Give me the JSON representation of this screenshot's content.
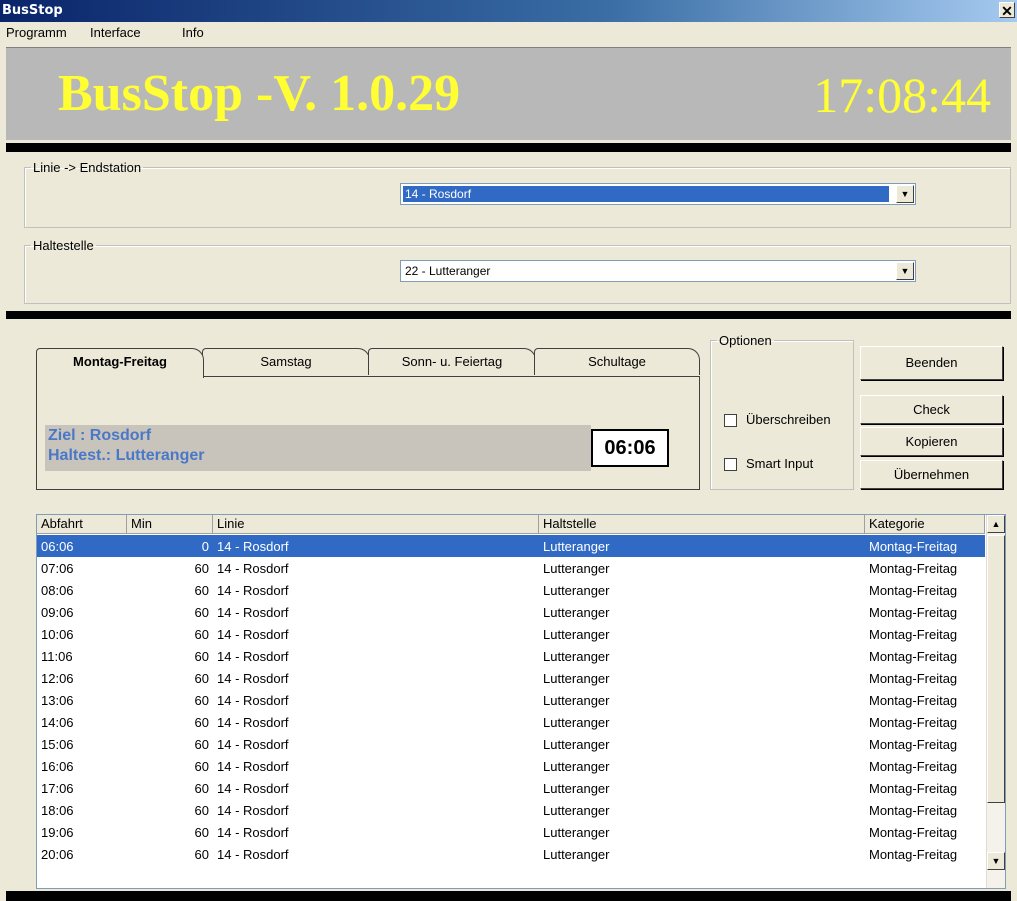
{
  "window": {
    "title": "BusStop",
    "close_glyph": "✕"
  },
  "menu": [
    "Programm",
    "Interface",
    "Info"
  ],
  "banner": {
    "app_name": "BusStop -V. 1.0.29",
    "clock": "17:08:44"
  },
  "linie_group": {
    "legend": "Linie -> Endstation",
    "selected": "14 - Rosdorf"
  },
  "haltestelle_group": {
    "legend": "Haltestelle",
    "selected": "22 - Lutteranger"
  },
  "tabs": [
    "Montag-Freitag",
    "Samstag",
    "Sonn- u. Feiertag",
    "Schultage"
  ],
  "active_tab": "Montag-Freitag",
  "info": {
    "ziel_line": "Ziel      : Rosdorf",
    "haltest_line": "Haltest.: Lutteranger",
    "time": "06:06"
  },
  "optionen": {
    "legend": "Optionen",
    "ueberschreiben": "Überschreiben",
    "smart_input": "Smart Input"
  },
  "buttons": {
    "beenden": "Beenden",
    "check": "Check",
    "kopieren": "Kopieren",
    "uebernehmen": "Übernehmen"
  },
  "table": {
    "columns": [
      "Abfahrt",
      "Min",
      "Linie",
      "Haltstelle",
      "Kategorie"
    ],
    "rows": [
      [
        "06:06",
        "0",
        "14 - Rosdorf",
        "Lutteranger",
        "Montag-Freitag"
      ],
      [
        "07:06",
        "60",
        "14 - Rosdorf",
        "Lutteranger",
        "Montag-Freitag"
      ],
      [
        "08:06",
        "60",
        "14 - Rosdorf",
        "Lutteranger",
        "Montag-Freitag"
      ],
      [
        "09:06",
        "60",
        "14 - Rosdorf",
        "Lutteranger",
        "Montag-Freitag"
      ],
      [
        "10:06",
        "60",
        "14 - Rosdorf",
        "Lutteranger",
        "Montag-Freitag"
      ],
      [
        "11:06",
        "60",
        "14 - Rosdorf",
        "Lutteranger",
        "Montag-Freitag"
      ],
      [
        "12:06",
        "60",
        "14 - Rosdorf",
        "Lutteranger",
        "Montag-Freitag"
      ],
      [
        "13:06",
        "60",
        "14 - Rosdorf",
        "Lutteranger",
        "Montag-Freitag"
      ],
      [
        "14:06",
        "60",
        "14 - Rosdorf",
        "Lutteranger",
        "Montag-Freitag"
      ],
      [
        "15:06",
        "60",
        "14 - Rosdorf",
        "Lutteranger",
        "Montag-Freitag"
      ],
      [
        "16:06",
        "60",
        "14 - Rosdorf",
        "Lutteranger",
        "Montag-Freitag"
      ],
      [
        "17:06",
        "60",
        "14 - Rosdorf",
        "Lutteranger",
        "Montag-Freitag"
      ],
      [
        "18:06",
        "60",
        "14 - Rosdorf",
        "Lutteranger",
        "Montag-Freitag"
      ],
      [
        "19:06",
        "60",
        "14 - Rosdorf",
        "Lutteranger",
        "Montag-Freitag"
      ],
      [
        "20:06",
        "60",
        "14 - Rosdorf",
        "Lutteranger",
        "Montag-Freitag"
      ]
    ],
    "selected_row": 0
  },
  "icons": {
    "dropdown": "chevron-down-icon",
    "scroll_up": "arrow-up-icon",
    "scroll_down": "arrow-down-icon"
  },
  "colors": {
    "banner_text": "#ffff33",
    "selection": "#316ac5",
    "info_text": "#4a78c8"
  }
}
